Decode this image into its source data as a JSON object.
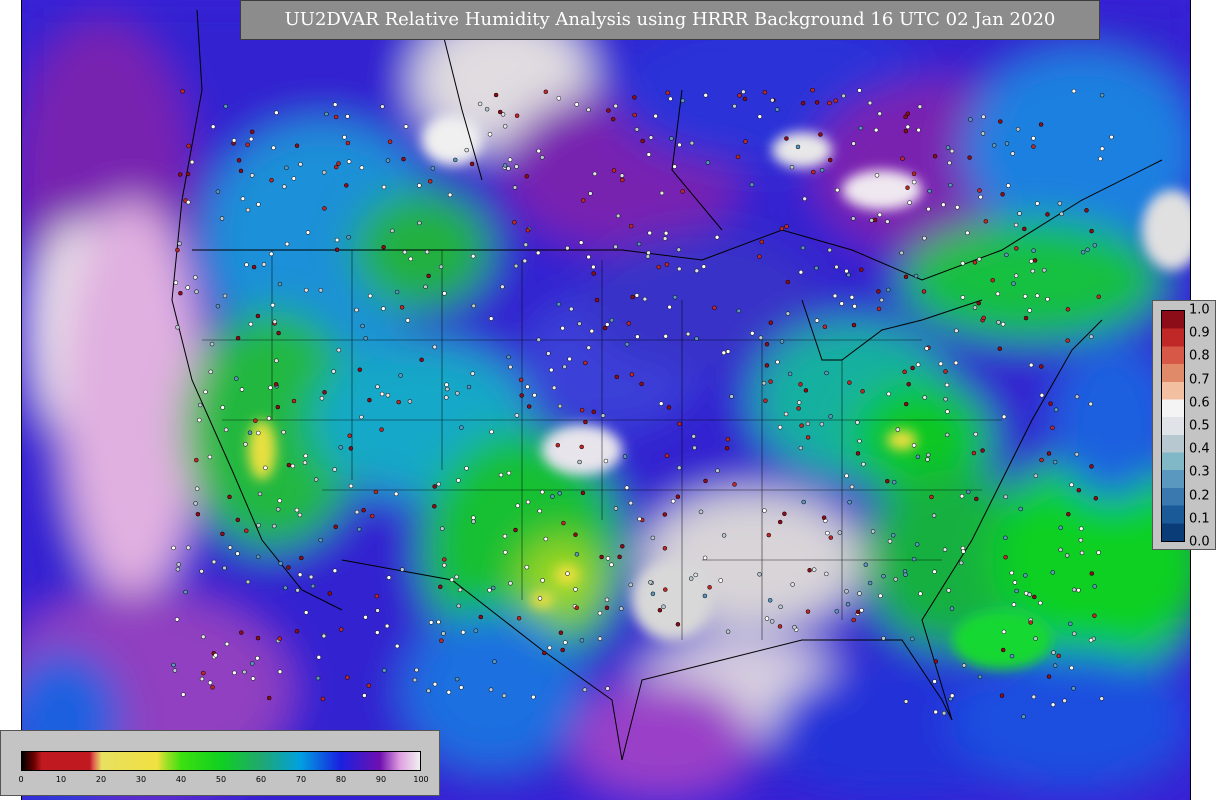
{
  "title": "UU2DVAR Relative Humidity Analysis using HRRR Background 16 UTC 02 Jan 2020",
  "humidity_legend": {
    "ticks": [
      "0",
      "10",
      "20",
      "30",
      "40",
      "50",
      "60",
      "70",
      "80",
      "90",
      "100"
    ],
    "min": 0,
    "max": 100,
    "stops": [
      {
        "value": 0,
        "color": "#000000"
      },
      {
        "value": 3,
        "color": "#6b0000"
      },
      {
        "value": 5,
        "color": "#c01a20"
      },
      {
        "value": 17,
        "color": "#c01a20"
      },
      {
        "value": 18,
        "color": "#e06050"
      },
      {
        "value": 20,
        "color": "#e8e060"
      },
      {
        "value": 34,
        "color": "#f0e040"
      },
      {
        "value": 36,
        "color": "#a8e028"
      },
      {
        "value": 40,
        "color": "#3ce010"
      },
      {
        "value": 50,
        "color": "#10d020"
      },
      {
        "value": 60,
        "color": "#20a870"
      },
      {
        "value": 70,
        "color": "#00a0e0"
      },
      {
        "value": 80,
        "color": "#1a20e0"
      },
      {
        "value": 90,
        "color": "#7010b0"
      },
      {
        "value": 95,
        "color": "#e0a0e0"
      },
      {
        "value": 100,
        "color": "#f0f0f0"
      }
    ]
  },
  "increment_legend": {
    "ticks": [
      "1.0",
      "0.9",
      "0.8",
      "0.7",
      "0.6",
      "0.5",
      "0.4",
      "0.3",
      "0.2",
      "0.1",
      "0.0"
    ],
    "colors": [
      "#0a3c78",
      "#1a5a98",
      "#3a78b0",
      "#5a98c0",
      "#80b8c8",
      "#b8c8d0",
      "#e0e4e8",
      "#f4f4f4",
      "#f2c0a0",
      "#e08a6a",
      "#d85848",
      "#c02828",
      "#8c0c18"
    ]
  }
}
